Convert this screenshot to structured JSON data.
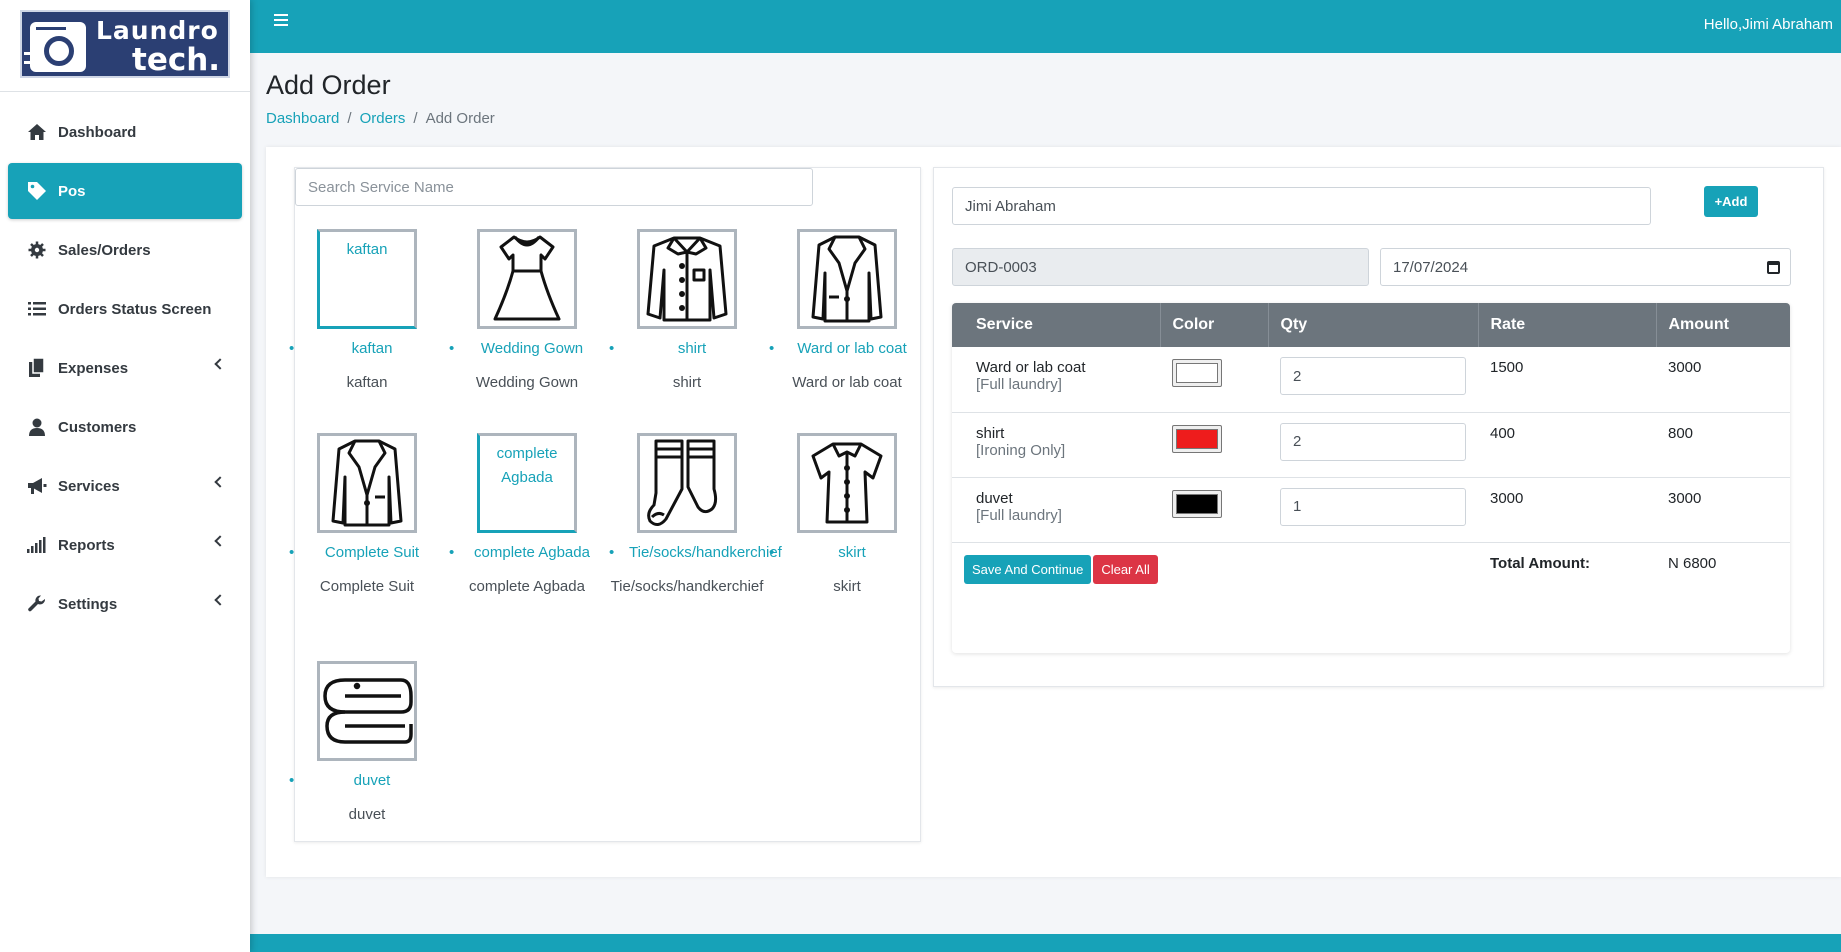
{
  "brand": {
    "line1": "Laundro",
    "line2": "tech."
  },
  "header": {
    "greeting": "Hello,Jimi Abraham"
  },
  "sidebar": {
    "items": [
      {
        "label": "Dashboard",
        "icon": "home-icon",
        "active": false,
        "has_children": false
      },
      {
        "label": "Pos",
        "icon": "tag-icon",
        "active": true,
        "has_children": false
      },
      {
        "label": "Sales/Orders",
        "icon": "gear-icon",
        "active": false,
        "has_children": false
      },
      {
        "label": "Orders Status Screen",
        "icon": "list-icon",
        "active": false,
        "has_children": false
      },
      {
        "label": "Expenses",
        "icon": "copy-icon",
        "active": false,
        "has_children": true
      },
      {
        "label": "Customers",
        "icon": "user-icon",
        "active": false,
        "has_children": false
      },
      {
        "label": "Services",
        "icon": "megaphone-icon",
        "active": false,
        "has_children": true
      },
      {
        "label": "Reports",
        "icon": "signal-icon",
        "active": false,
        "has_children": true
      },
      {
        "label": "Settings",
        "icon": "wrench-icon",
        "active": false,
        "has_children": true
      }
    ]
  },
  "page": {
    "title": "Add Order",
    "breadcrumb": [
      "Dashboard",
      "Orders",
      "Add Order"
    ]
  },
  "services_panel": {
    "search_placeholder": "Search Service Name",
    "services": [
      {
        "name": "kaftan",
        "link": "kaftan",
        "image": "broken",
        "alt": "kaftan"
      },
      {
        "name": "Wedding Gown",
        "link": "Wedding Gown",
        "image": "dress-icon"
      },
      {
        "name": "shirt",
        "link": "shirt",
        "image": "shirt-icon"
      },
      {
        "name": "Ward or lab coat",
        "link": "Ward or lab coat",
        "image": "blazer-icon"
      },
      {
        "name": "Complete Suit",
        "link": "Complete Suit",
        "image": "suit-icon"
      },
      {
        "name": "complete Agbada",
        "link": "complete Agbada",
        "image": "broken",
        "alt": "complete Agbada"
      },
      {
        "name": "Tie/socks/handkerchief",
        "link": "Tie/socks/handkerchief",
        "image": "socks-icon"
      },
      {
        "name": "skirt",
        "link": "skirt",
        "image": "blouse-icon"
      },
      {
        "name": "duvet",
        "link": "duvet",
        "image": "duvet-icon"
      }
    ]
  },
  "order": {
    "customer": "Jimi Abraham",
    "add_label": "+Add",
    "order_no": "ORD-0003",
    "date": "17/07/2024",
    "table": {
      "headers": [
        "Service",
        "Color",
        "Qty",
        "Rate",
        "Amount"
      ],
      "rows": [
        {
          "service": "Ward or lab coat",
          "type": "[Full laundry]",
          "color": "#ffffff",
          "qty": "2",
          "rate": "1500",
          "amount": "3000"
        },
        {
          "service": "shirt",
          "type": "[Ironing Only]",
          "color": "#ee1c1c",
          "qty": "2",
          "rate": "400",
          "amount": "800"
        },
        {
          "service": "duvet",
          "type": "[Full laundry]",
          "color": "#000000",
          "qty": "1",
          "rate": "3000",
          "amount": "3000"
        }
      ],
      "total_label": "Total Amount:",
      "total_value": "N 6800"
    },
    "save_label": "Save And Continue",
    "clear_label": "Clear All"
  },
  "colors": {
    "accent": "#17a2b8",
    "danger": "#dc3545",
    "table_header": "#6c757d"
  }
}
